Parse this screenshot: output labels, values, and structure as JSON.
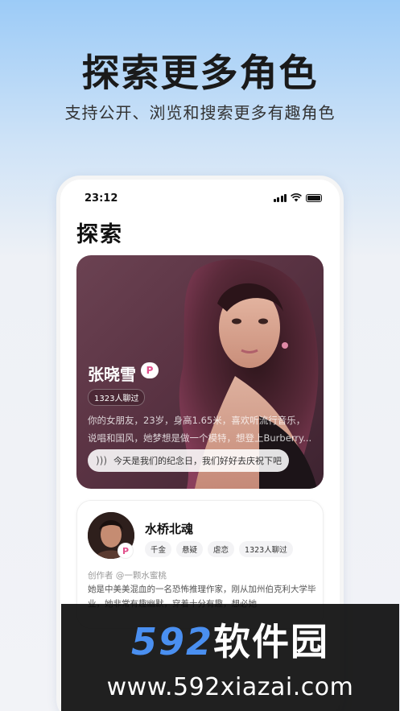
{
  "promo": {
    "headline": "探索更多角色",
    "subhead": "支持公开、浏览和搜索更多有趣角色"
  },
  "status_bar": {
    "time": "23:12"
  },
  "page": {
    "title": "探索"
  },
  "featured_card": {
    "name": "张晓雪",
    "badge_icon": "P",
    "chat_count": "1323人聊过",
    "description": "你的女朋友，23岁，身高1.65米，喜欢听流行音乐，说唱和国风，她梦想是做一个模特，想登上Burberry...",
    "voice_text": "今天是我们的纪念日，我们好好去庆祝下吧",
    "voice_icon": "sound-wave-icon"
  },
  "character_card": {
    "name": "水桥北魂",
    "badge_icon": "P",
    "tags": [
      "千金",
      "悬疑",
      "虐恋",
      "1323人聊过"
    ],
    "creator": "创作者 @一颗水蜜桃",
    "description": "她是中美美混血的一名恐怖推理作家，刚从加州伯克利大学毕业，她非常有趣幽默，穿着十分有趣，想必她"
  },
  "watermark": {
    "brand_num": "592",
    "brand_cn": "软件园",
    "url": "www.592xiazai.com"
  },
  "colors": {
    "accent_pink": "#e14f8b",
    "watermark_blue": "#4a8ff0"
  }
}
